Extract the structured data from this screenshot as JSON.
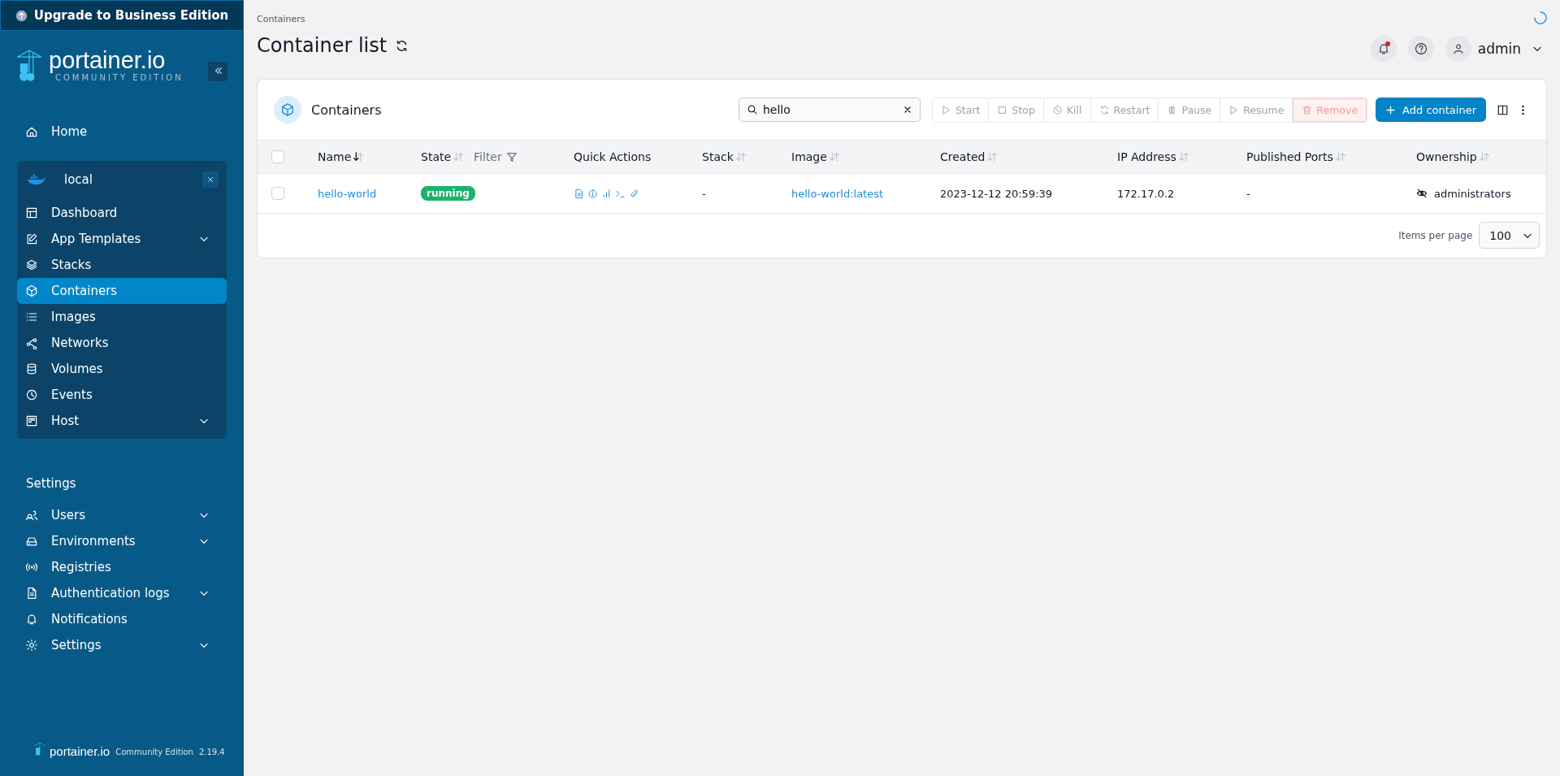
{
  "sidebar": {
    "upgrade": "Upgrade to Business Edition",
    "logo": {
      "name": "portainer.io",
      "edition": "COMMUNITY EDITION"
    },
    "home": {
      "label": "Home",
      "selected": false
    },
    "environment": {
      "name": "local",
      "items": [
        {
          "label": "Dashboard",
          "selected": false,
          "has_submenu": false
        },
        {
          "label": "App Templates",
          "selected": false,
          "has_submenu": true
        },
        {
          "label": "Stacks",
          "selected": false,
          "has_submenu": false
        },
        {
          "label": "Containers",
          "selected": true,
          "has_submenu": false
        },
        {
          "label": "Images",
          "selected": false,
          "has_submenu": false
        },
        {
          "label": "Networks",
          "selected": false,
          "has_submenu": false
        },
        {
          "label": "Volumes",
          "selected": false,
          "has_submenu": false
        },
        {
          "label": "Events",
          "selected": false,
          "has_submenu": false
        },
        {
          "label": "Host",
          "selected": false,
          "has_submenu": true
        }
      ]
    },
    "settings_heading": "Settings",
    "settings_items": [
      {
        "label": "Users",
        "selected": false,
        "has_submenu": true
      },
      {
        "label": "Environments",
        "selected": false,
        "has_submenu": true
      },
      {
        "label": "Registries",
        "selected": false,
        "has_submenu": false
      },
      {
        "label": "Authentication logs",
        "selected": false,
        "has_submenu": true
      },
      {
        "label": "Notifications",
        "selected": false,
        "has_submenu": false
      },
      {
        "label": "Settings",
        "selected": false,
        "has_submenu": true
      }
    ],
    "footer": {
      "name": "portainer.io",
      "edition": "Community Edition",
      "version": "2.19.4"
    }
  },
  "header": {
    "breadcrumb": "Containers",
    "title": "Container list",
    "user": "admin",
    "notification_unread": true
  },
  "card": {
    "title": "Containers",
    "search": {
      "value": "hello"
    },
    "actions": [
      {
        "label": "Start",
        "kind": "normal",
        "disabled": true
      },
      {
        "label": "Stop",
        "kind": "normal",
        "disabled": true
      },
      {
        "label": "Kill",
        "kind": "normal",
        "disabled": true
      },
      {
        "label": "Restart",
        "kind": "normal",
        "disabled": true
      },
      {
        "label": "Pause",
        "kind": "normal",
        "disabled": true
      },
      {
        "label": "Resume",
        "kind": "normal",
        "disabled": true
      },
      {
        "label": "Remove",
        "kind": "danger",
        "disabled": true
      }
    ],
    "add_button": "Add container",
    "table": {
      "select_all_checked": false,
      "columns": [
        {
          "label": "Name",
          "sorted": true
        },
        {
          "label": "State",
          "sorted": false,
          "filter": "Filter"
        },
        {
          "label": "Quick Actions"
        },
        {
          "label": "Stack",
          "sorted": false
        },
        {
          "label": "Image",
          "sorted": false
        },
        {
          "label": "Created",
          "sorted": false
        },
        {
          "label": "IP Address",
          "sorted": false
        },
        {
          "label": "Published Ports",
          "sorted": false
        },
        {
          "label": "Ownership",
          "sorted": false
        }
      ],
      "rows": [
        {
          "checked": false,
          "name": "hello-world",
          "state": "running",
          "stack": "-",
          "image": "hello-world:latest",
          "created": "2023-12-12 20:59:39",
          "ip": "172.17.0.2",
          "ports": "-",
          "ownership": "administrators"
        }
      ]
    },
    "pagination": {
      "label": "Items per page",
      "value": "100"
    }
  }
}
